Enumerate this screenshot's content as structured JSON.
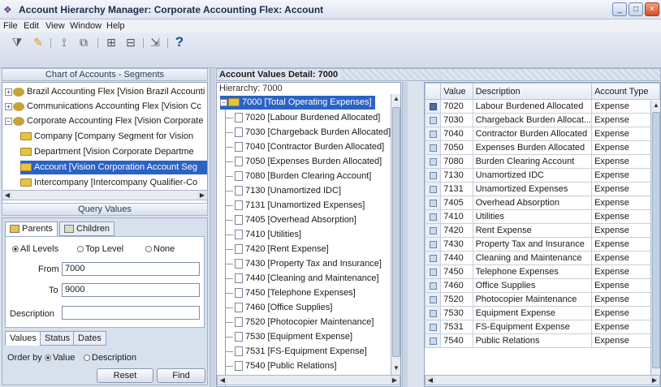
{
  "window": {
    "title": "Account Hierarchy Manager: Corporate Accounting Flex: Account",
    "minimize": "_",
    "maximize": "□",
    "close": "×"
  },
  "menu": [
    "File",
    "Edit",
    "View",
    "Window",
    "Help"
  ],
  "toolbar": {
    "icons": [
      "filter-icon",
      "edit-icon",
      "tree-icon",
      "copy-icon",
      "add-icon",
      "remove-icon",
      "export-icon",
      "help-icon"
    ],
    "help_label": "?"
  },
  "left": {
    "header": "Chart of Accounts - Segments",
    "tree": [
      {
        "label": "Brazil Accounting Flex [Vision Brazil Accounti",
        "level": 0,
        "expander": "+"
      },
      {
        "label": "Communications Accounting Flex [Vision Cc",
        "level": 0,
        "expander": "+"
      },
      {
        "label": "Corporate Accounting Flex [Vision Corporate",
        "level": 0,
        "expander": "−"
      },
      {
        "label": "Company [Company Segment for Vision",
        "level": 1
      },
      {
        "label": "Department [Vision Corporate Departme",
        "level": 1
      },
      {
        "label": "Account [Vision Corporation Account Seg",
        "level": 1,
        "selected": true
      },
      {
        "label": "Intercompany [Intercompany Qualifier-Co",
        "level": 1
      }
    ],
    "query_header": "Query Values",
    "tabs": {
      "parents": "Parents",
      "children": "Children"
    },
    "levels": {
      "all": "All Levels",
      "top": "Top Level",
      "none": "None",
      "selected": "all"
    },
    "from_label": "From",
    "from_value": "7000",
    "to_label": "To",
    "to_value": "9000",
    "description_label": "Description",
    "description_value": "",
    "bottom_tabs": {
      "values": "Values",
      "status": "Status",
      "dates": "Dates"
    },
    "order_by_label": "Order by",
    "order_value": "Value",
    "order_description": "Description",
    "order_selected": "Value",
    "reset": "Reset",
    "find": "Find"
  },
  "detail": {
    "title": "Account Values Detail: 7000",
    "hierarchy_label": "Hierarchy: 7000",
    "root": "7000 [Total Operating Expenses]",
    "children": [
      "7020 [Labour Burdened Allocated]",
      "7030 [Chargeback Burden Allocated]",
      "7040 [Contractor Burden Allocated]",
      "7050 [Expenses Burden Allocated]",
      "7080 [Burden Clearing Account]",
      "7130 [Unamortized IDC]",
      "7131 [Unamortized Expenses]",
      "7405 [Overhead Absorption]",
      "7410 [Utilities]",
      "7420 [Rent Expense]",
      "7430 [Property Tax and Insurance]",
      "7440 [Cleaning and Maintenance]",
      "7450 [Telephone Expenses]",
      "7460 [Office Supplies]",
      "7520 [Photocopier Maintenance]",
      "7530 [Equipment Expense]",
      "7531 [FS-Equipment Expense]",
      "7540 [Public Relations]"
    ],
    "columns": [
      "Value",
      "Description",
      "Account Type"
    ],
    "rows": [
      [
        "7020",
        "Labour Burdened Allocated",
        "Expense"
      ],
      [
        "7030",
        "Chargeback Burden Allocat...",
        "Expense"
      ],
      [
        "7040",
        "Contractor Burden Allocated",
        "Expense"
      ],
      [
        "7050",
        "Expenses Burden Allocated",
        "Expense"
      ],
      [
        "7080",
        "Burden Clearing Account",
        "Expense"
      ],
      [
        "7130",
        "Unamortized IDC",
        "Expense"
      ],
      [
        "7131",
        "Unamortized Expenses",
        "Expense"
      ],
      [
        "7405",
        "Overhead Absorption",
        "Expense"
      ],
      [
        "7410",
        "Utilities",
        "Expense"
      ],
      [
        "7420",
        "Rent Expense",
        "Expense"
      ],
      [
        "7430",
        "Property Tax and Insurance",
        "Expense"
      ],
      [
        "7440",
        "Cleaning and Maintenance",
        "Expense"
      ],
      [
        "7450",
        "Telephone Expenses",
        "Expense"
      ],
      [
        "7460",
        "Office Supplies",
        "Expense"
      ],
      [
        "7520",
        "Photocopier Maintenance",
        "Expense"
      ],
      [
        "7530",
        "Equipment Expense",
        "Expense"
      ],
      [
        "7531",
        "FS-Equipment Expense",
        "Expense"
      ],
      [
        "7540",
        "Public Relations",
        "Expense"
      ]
    ]
  },
  "colors": {
    "selection": "#2b63c4",
    "accent": "#1e4a96"
  }
}
